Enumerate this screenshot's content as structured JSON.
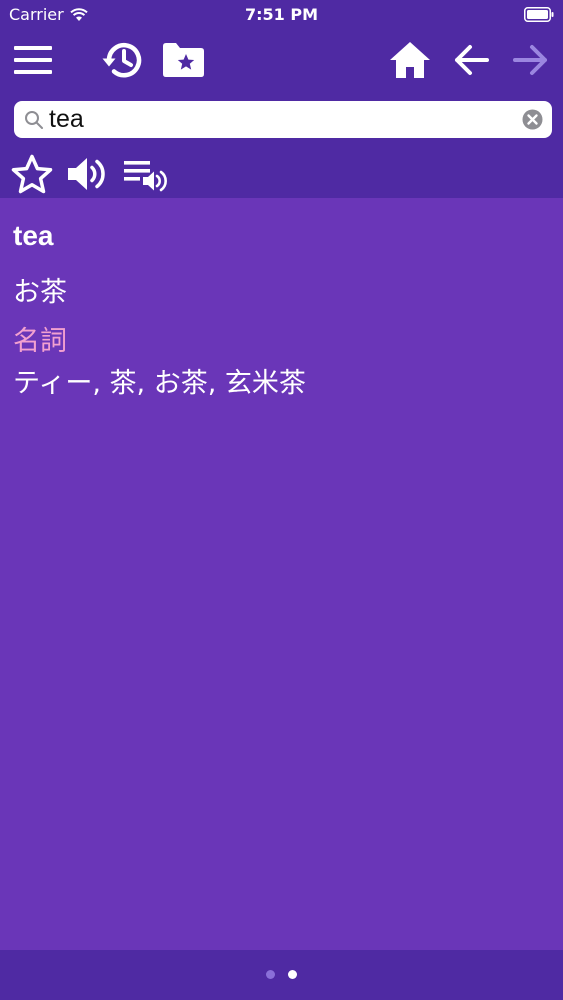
{
  "status_bar": {
    "carrier": "Carrier",
    "time": "7:51 PM"
  },
  "toolbar": {
    "icons": [
      "menu-icon",
      "history-icon",
      "favorites-folder-icon",
      "home-icon",
      "back-arrow-icon",
      "forward-arrow-icon"
    ],
    "forward_enabled": false
  },
  "search": {
    "value": "tea",
    "placeholder": ""
  },
  "actions": {
    "icons": [
      "star-outline-icon",
      "speaker-icon",
      "playlist-audio-icon"
    ]
  },
  "entry": {
    "headword": "tea",
    "reading": "お茶",
    "part_of_speech": "名詞",
    "translations": "ティー, 茶, お茶, 玄米茶"
  },
  "pager": {
    "page_count": 2,
    "current_page": 2
  },
  "colors": {
    "header_bg": "#4f2aa3",
    "content_bg": "#6a36b8",
    "pos_text": "#f2a0d0",
    "disabled_icon": "#9b86e0"
  }
}
